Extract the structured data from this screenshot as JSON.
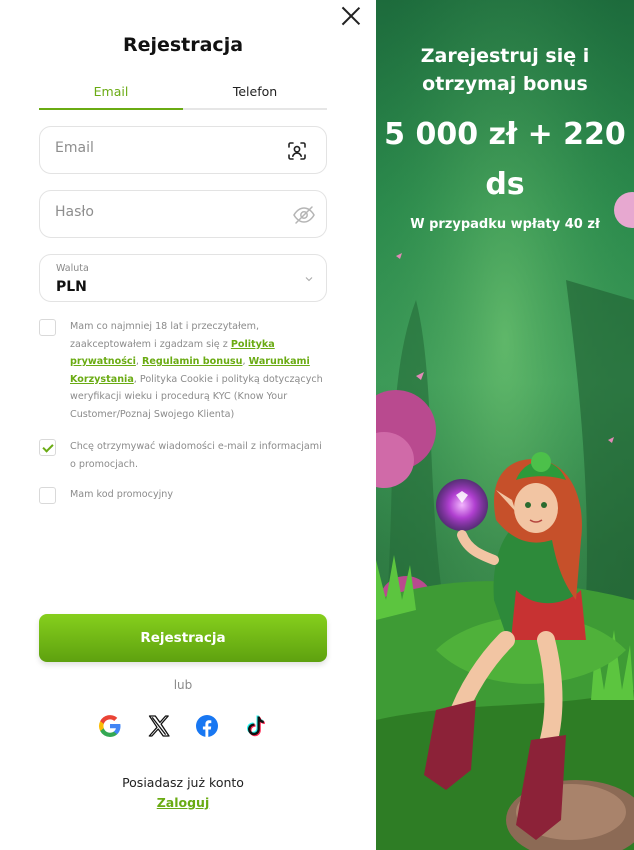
{
  "form": {
    "title": "Rejestracja",
    "tabs": [
      {
        "label": "Email",
        "active": true
      },
      {
        "label": "Telefon",
        "active": false
      }
    ],
    "email_placeholder": "Email",
    "password_placeholder": "Hasło",
    "currency": {
      "label": "Waluta",
      "value": "PLN"
    },
    "checkboxes": {
      "terms": {
        "checked": false,
        "text_before": "Mam co najmniej 18 lat i przeczytałem, zaakceptowałem i zgadzam się z ",
        "link_privacy": "Polityka prywatności",
        "sep1": ", ",
        "link_bonus": "Regulamin bonusu",
        "sep2": ", ",
        "link_terms": "Warunkami Korzystania",
        "text_after": ", Polityka Cookie i polityką dotyczących weryfikacji wieku i procedurą KYC (Know Your Customer/Poznaj Swojego Klienta)"
      },
      "newsletter": {
        "checked": true,
        "text": "Chcę otrzymywać wiadomości e-mail z informacjami o promocjach."
      },
      "promo": {
        "checked": false,
        "text": "Mam kod promocyjny"
      }
    },
    "submit_label": "Rejestracja",
    "or_label": "lub",
    "social": [
      "google-icon",
      "x-icon",
      "facebook-icon",
      "tiktok-icon"
    ],
    "have_account": "Posiadasz już konto",
    "login_label": "Zaloguj"
  },
  "promo": {
    "headline": "Zarejestruj się i otrzymaj bonus",
    "bonus": "5 000 zł + 220 ds",
    "condition": "W przypadku wpłaty 40 zł"
  },
  "colors": {
    "accent": "#6aab13",
    "button": "#74bb17",
    "promo_bg": "#2b8a4c"
  }
}
